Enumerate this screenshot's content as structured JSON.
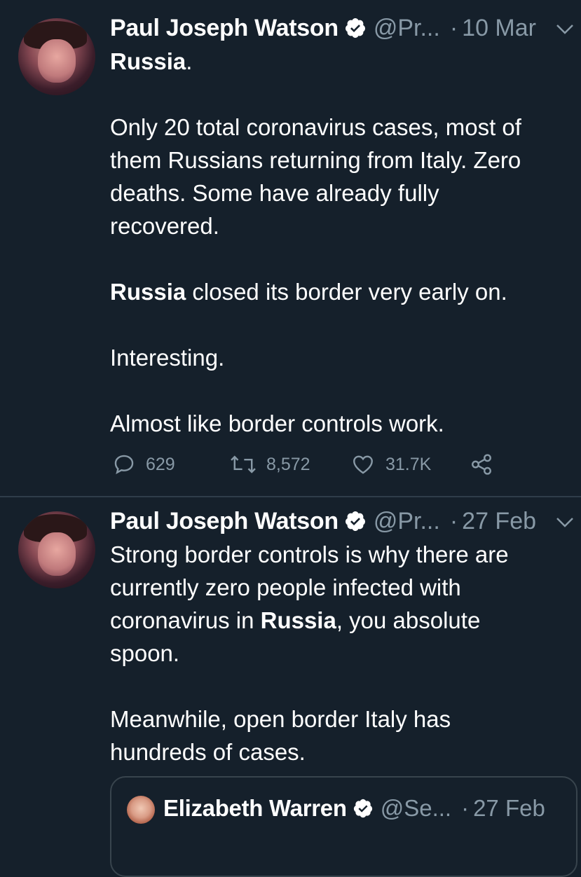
{
  "tweets": [
    {
      "name": "Paul Joseph Watson",
      "handle": "@Pr...",
      "separator": "·",
      "date": "10 Mar",
      "lines": [
        {
          "bold": "Russia",
          "rest": "."
        },
        {
          "text": ""
        },
        {
          "text": "Only 20 total coronavirus cases, most of"
        },
        {
          "text": "them Russians returning from Italy. Zero"
        },
        {
          "text": "deaths. Some have already fully"
        },
        {
          "text": "recovered."
        }
      ],
      "paragraph2": {
        "bold": "Russia",
        "rest": " closed its border very early on."
      },
      "paragraph3": "Interesting.",
      "paragraph4": "Almost like border controls work.",
      "actions": {
        "replies": "629",
        "retweets": "8,572",
        "likes": "31.7K"
      }
    },
    {
      "name": "Paul Joseph Watson",
      "handle": "@Pr...",
      "separator": "·",
      "date": "27 Feb",
      "line1": "Strong border controls is why there are",
      "line2": "currently zero people infected with",
      "line3_pre": "coronavirus in ",
      "line3_bold": "Russia",
      "line3_post": ", you absolute",
      "line4": "spoon.",
      "line5": "Meanwhile, open border Italy has",
      "line6": "hundreds of cases."
    }
  ],
  "quoted_tweet": {
    "name": "Elizabeth Warren",
    "handle": "@Se...",
    "separator": "·",
    "date": "27 Feb"
  },
  "colors": {
    "background": "#15202b",
    "text": "#ffffff",
    "secondary": "#8899a6",
    "divider": "#2f3d4a"
  }
}
